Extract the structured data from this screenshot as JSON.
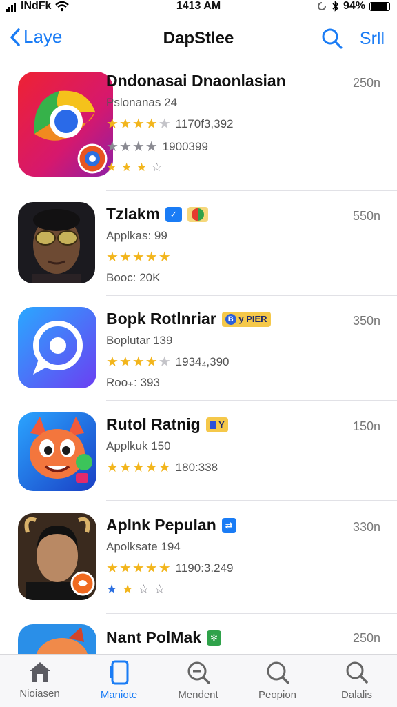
{
  "status": {
    "carrier": "lNdFk",
    "time": "1413 AM",
    "battery": "94%",
    "battery_level": 0.94
  },
  "nav": {
    "back_label": "Laye",
    "title": "DapStlee",
    "right_label": "Srll"
  },
  "apps": [
    {
      "name": "Dndonasai Dnaonlasian",
      "line1": "Pslonanas 24",
      "rating1": "1170f3,392",
      "rating2": "1900399",
      "size": "250n",
      "icon": "chrome-like-app-icon"
    },
    {
      "name": "Tzlakm",
      "line1": "Applkas: 99",
      "line2": "Booc: 20K",
      "size": "550n",
      "icon": "portrait-app-icon"
    },
    {
      "name": "Bopk Rotlnriar",
      "badge": "y PIER",
      "line1": "Boplutar 139",
      "rating1": "1934₄,390",
      "line2": "Roo₊: 393",
      "size": "350n",
      "icon": "chat-bubble-app-icon"
    },
    {
      "name": "Rutol Ratnig",
      "badge": "Y",
      "line1": "Applkuk 150",
      "rating1": "180:338",
      "size": "150n",
      "icon": "cartoon-fox-app-icon"
    },
    {
      "name": "Aplnk Pepulan",
      "line1": "Apolksate 194",
      "rating1": "1190:3.249",
      "size": "330n",
      "icon": "avatar-app-icon"
    },
    {
      "name": "Nant PolMak",
      "size": "250n",
      "icon": "mascot-app-icon"
    }
  ],
  "tabs": [
    {
      "label": "Nioiasen",
      "icon": "home-icon",
      "active": false
    },
    {
      "label": "Maniote",
      "icon": "phone-icon",
      "active": true
    },
    {
      "label": "Mendent",
      "icon": "search-minus-icon",
      "active": false
    },
    {
      "label": "Peopion",
      "icon": "search-icon",
      "active": false
    },
    {
      "label": "Dalalis",
      "icon": "search-icon",
      "active": false
    }
  ],
  "colors": {
    "accent": "#1a7cf5",
    "star": "#f2b51c",
    "separator": "#e1e1e6"
  }
}
